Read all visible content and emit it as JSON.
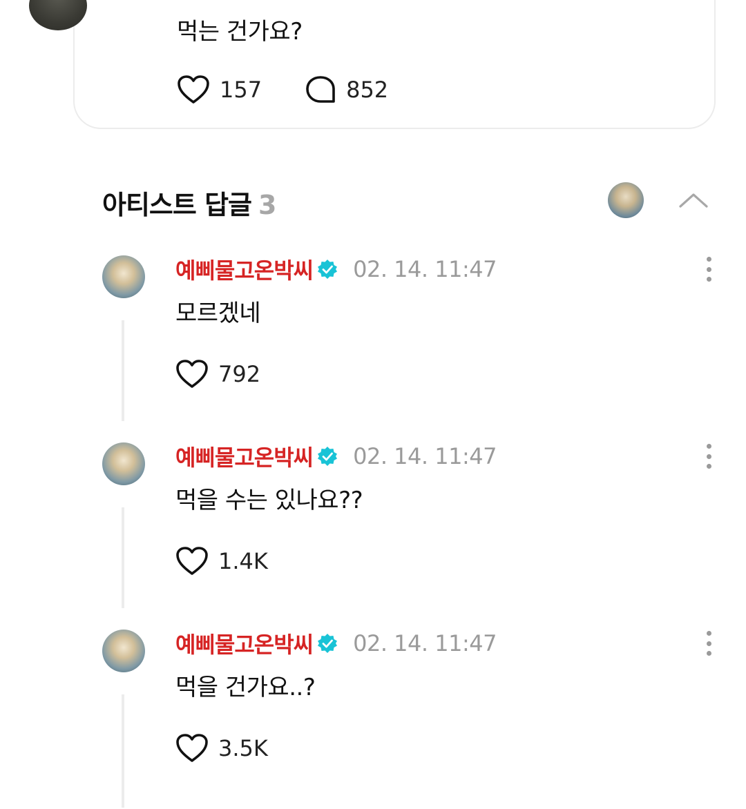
{
  "post": {
    "text": "먹는 건가요?",
    "like_count": "157",
    "comment_count": "852"
  },
  "section": {
    "title": "아티스트 답글",
    "count": "3"
  },
  "replies": [
    {
      "author": "예삐물고온박씨",
      "time": "02. 14. 11:47",
      "text": "모르겠네",
      "likes": "792"
    },
    {
      "author": "예삐물고온박씨",
      "time": "02. 14. 11:47",
      "text": "먹을 수는 있나요??",
      "likes": "1.4K"
    },
    {
      "author": "예삐물고온박씨",
      "time": "02. 14. 11:47",
      "text": "먹을 건가요..?",
      "likes": "3.5K"
    }
  ],
  "colors": {
    "author": "#d62424",
    "verified": "#19c3d6",
    "muted": "#9a9a9a"
  },
  "icons": {
    "like": "heart-outline-icon",
    "comment": "speech-bubble-icon",
    "verified": "verified-badge-icon",
    "more": "vertical-dots-icon",
    "collapse": "chevron-up-icon"
  }
}
